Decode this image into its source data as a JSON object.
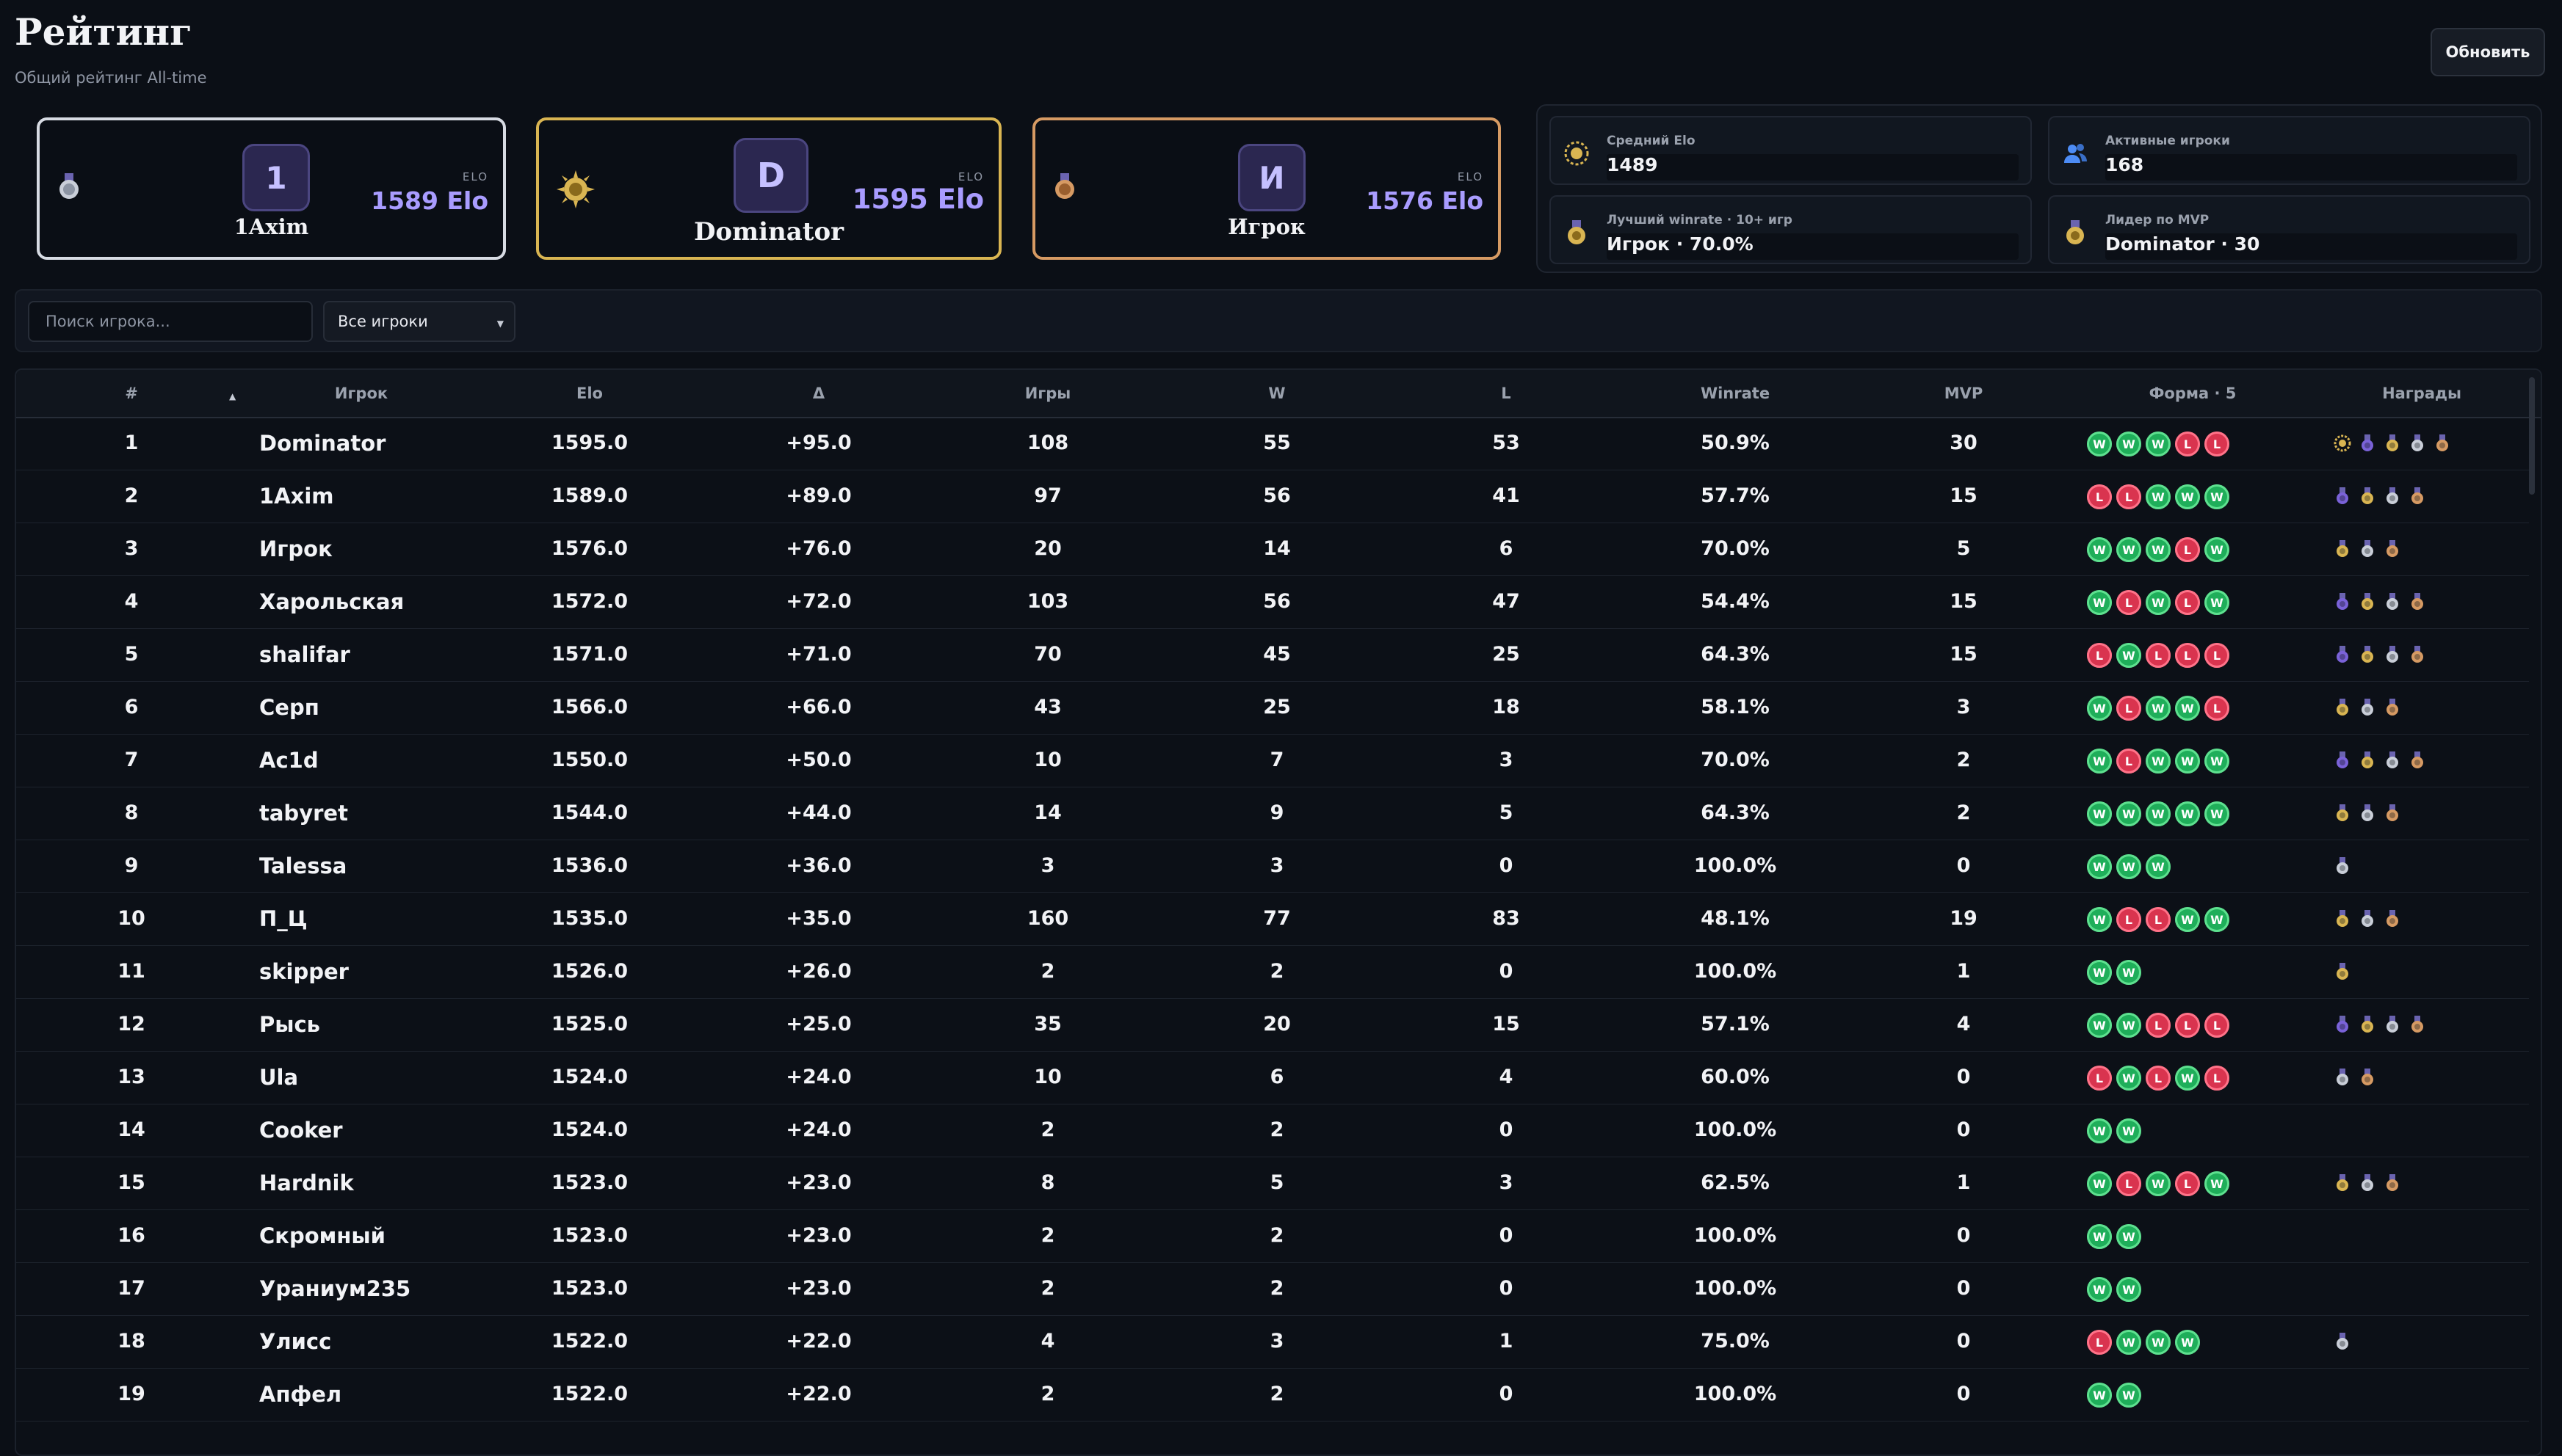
{
  "page": {
    "title": "Рейтинг",
    "subtitle": "Общий рейтинг All-time",
    "refresh_label": "Обновить"
  },
  "podium": [
    {
      "place": 2,
      "initial": "1",
      "name": "1Axim",
      "elo_label": "ELO",
      "elo": "1589 Elo",
      "medal_icon": "medal-silver-icon"
    },
    {
      "place": 1,
      "initial": "D",
      "name": "Dominator",
      "elo_label": "ELO",
      "elo": "1595 Elo",
      "medal_icon": "crown-gold-icon"
    },
    {
      "place": 3,
      "initial": "И",
      "name": "Игрок",
      "elo_label": "ELO",
      "elo": "1576 Elo",
      "medal_icon": "medal-bronze-icon"
    }
  ],
  "stats": [
    {
      "label": "Средний Elo",
      "value": "1489",
      "icon": "sun-medal-icon"
    },
    {
      "label": "Активные игроки",
      "value": "168",
      "icon": "users-icon"
    },
    {
      "label": "Лучший winrate · 10+ игр",
      "value": "Игрок · 70.0%",
      "icon": "medal-icon"
    },
    {
      "label": "Лидер по MVP",
      "value": "Dominator · 30",
      "icon": "medal-icon"
    }
  ],
  "filters": {
    "search_placeholder": "Поиск игрока...",
    "select_value": "Все игроки"
  },
  "table": {
    "headers": [
      "#",
      "Игрок",
      "Elo",
      "Δ",
      "Игры",
      "W",
      "L",
      "Winrate",
      "MVP",
      "Форма · 5",
      "Награды"
    ],
    "rows": [
      {
        "rank": "1",
        "name": "Dominator",
        "elo": "1595.0",
        "delta": "+95.0",
        "games": "108",
        "w": "55",
        "l": "53",
        "winrate": "50.9%",
        "mvp": "30",
        "form": [
          "W",
          "W",
          "W",
          "L",
          "L"
        ],
        "awards": [
          "ring",
          "purple",
          "gold",
          "silver",
          "bronze"
        ]
      },
      {
        "rank": "2",
        "name": "1Axim",
        "elo": "1589.0",
        "delta": "+89.0",
        "games": "97",
        "w": "56",
        "l": "41",
        "winrate": "57.7%",
        "mvp": "15",
        "form": [
          "L",
          "L",
          "W",
          "W",
          "W"
        ],
        "awards": [
          "purple",
          "gold",
          "silver",
          "bronze"
        ]
      },
      {
        "rank": "3",
        "name": "Игрок",
        "elo": "1576.0",
        "delta": "+76.0",
        "games": "20",
        "w": "14",
        "l": "6",
        "winrate": "70.0%",
        "mvp": "5",
        "form": [
          "W",
          "W",
          "W",
          "L",
          "W"
        ],
        "awards": [
          "gold",
          "silver",
          "bronze"
        ]
      },
      {
        "rank": "4",
        "name": "Харольская",
        "elo": "1572.0",
        "delta": "+72.0",
        "games": "103",
        "w": "56",
        "l": "47",
        "winrate": "54.4%",
        "mvp": "15",
        "form": [
          "W",
          "L",
          "W",
          "L",
          "W"
        ],
        "awards": [
          "purple",
          "gold",
          "silver",
          "bronze"
        ]
      },
      {
        "rank": "5",
        "name": "shalifar",
        "elo": "1571.0",
        "delta": "+71.0",
        "games": "70",
        "w": "45",
        "l": "25",
        "winrate": "64.3%",
        "mvp": "15",
        "form": [
          "L",
          "W",
          "L",
          "L",
          "L"
        ],
        "awards": [
          "purple",
          "gold",
          "silver",
          "bronze"
        ]
      },
      {
        "rank": "6",
        "name": "Серп",
        "elo": "1566.0",
        "delta": "+66.0",
        "games": "43",
        "w": "25",
        "l": "18",
        "winrate": "58.1%",
        "mvp": "3",
        "form": [
          "W",
          "L",
          "W",
          "W",
          "L"
        ],
        "awards": [
          "gold",
          "silver",
          "bronze"
        ]
      },
      {
        "rank": "7",
        "name": "Ac1d",
        "elo": "1550.0",
        "delta": "+50.0",
        "games": "10",
        "w": "7",
        "l": "3",
        "winrate": "70.0%",
        "mvp": "2",
        "form": [
          "W",
          "L",
          "W",
          "W",
          "W"
        ],
        "awards": [
          "purple",
          "gold",
          "silver",
          "bronze"
        ]
      },
      {
        "rank": "8",
        "name": "tabyret",
        "elo": "1544.0",
        "delta": "+44.0",
        "games": "14",
        "w": "9",
        "l": "5",
        "winrate": "64.3%",
        "mvp": "2",
        "form": [
          "W",
          "W",
          "W",
          "W",
          "W"
        ],
        "awards": [
          "gold",
          "silver",
          "bronze"
        ]
      },
      {
        "rank": "9",
        "name": "Talessa",
        "elo": "1536.0",
        "delta": "+36.0",
        "games": "3",
        "w": "3",
        "l": "0",
        "winrate": "100.0%",
        "mvp": "0",
        "form": [
          "W",
          "W",
          "W"
        ],
        "awards": [
          "silver"
        ]
      },
      {
        "rank": "10",
        "name": "П_Ц",
        "elo": "1535.0",
        "delta": "+35.0",
        "games": "160",
        "w": "77",
        "l": "83",
        "winrate": "48.1%",
        "mvp": "19",
        "form": [
          "W",
          "L",
          "L",
          "W",
          "W"
        ],
        "awards": [
          "gold",
          "silver",
          "bronze"
        ]
      },
      {
        "rank": "11",
        "name": "skipper",
        "elo": "1526.0",
        "delta": "+26.0",
        "games": "2",
        "w": "2",
        "l": "0",
        "winrate": "100.0%",
        "mvp": "1",
        "form": [
          "W",
          "W"
        ],
        "awards": [
          "gold"
        ]
      },
      {
        "rank": "12",
        "name": "Рысь",
        "elo": "1525.0",
        "delta": "+25.0",
        "games": "35",
        "w": "20",
        "l": "15",
        "winrate": "57.1%",
        "mvp": "4",
        "form": [
          "W",
          "W",
          "L",
          "L",
          "L"
        ],
        "awards": [
          "purple",
          "gold",
          "silver",
          "bronze"
        ]
      },
      {
        "rank": "13",
        "name": "Ula",
        "elo": "1524.0",
        "delta": "+24.0",
        "games": "10",
        "w": "6",
        "l": "4",
        "winrate": "60.0%",
        "mvp": "0",
        "form": [
          "L",
          "W",
          "L",
          "W",
          "L"
        ],
        "awards": [
          "silver",
          "bronze"
        ]
      },
      {
        "rank": "14",
        "name": "Cooker",
        "elo": "1524.0",
        "delta": "+24.0",
        "games": "2",
        "w": "2",
        "l": "0",
        "winrate": "100.0%",
        "mvp": "0",
        "form": [
          "W",
          "W"
        ],
        "awards": []
      },
      {
        "rank": "15",
        "name": "Hardnik",
        "elo": "1523.0",
        "delta": "+23.0",
        "games": "8",
        "w": "5",
        "l": "3",
        "winrate": "62.5%",
        "mvp": "1",
        "form": [
          "W",
          "L",
          "W",
          "L",
          "W"
        ],
        "awards": [
          "gold",
          "silver",
          "bronze"
        ]
      },
      {
        "rank": "16",
        "name": "Скромный",
        "elo": "1523.0",
        "delta": "+23.0",
        "games": "2",
        "w": "2",
        "l": "0",
        "winrate": "100.0%",
        "mvp": "0",
        "form": [
          "W",
          "W"
        ],
        "awards": []
      },
      {
        "rank": "17",
        "name": "Ураниум235",
        "elo": "1523.0",
        "delta": "+23.0",
        "games": "2",
        "w": "2",
        "l": "0",
        "winrate": "100.0%",
        "mvp": "0",
        "form": [
          "W",
          "W"
        ],
        "awards": []
      },
      {
        "rank": "18",
        "name": "Улисс",
        "elo": "1522.0",
        "delta": "+22.0",
        "games": "4",
        "w": "3",
        "l": "1",
        "winrate": "75.0%",
        "mvp": "0",
        "form": [
          "L",
          "W",
          "W",
          "W"
        ],
        "awards": [
          "silver"
        ]
      },
      {
        "rank": "19",
        "name": "Апфел",
        "elo": "1522.0",
        "delta": "+22.0",
        "games": "2",
        "w": "2",
        "l": "0",
        "winrate": "100.0%",
        "mvp": "0",
        "form": [
          "W",
          "W"
        ],
        "awards": []
      }
    ]
  },
  "colors": {
    "gold": "#d9b552",
    "silver": "#c9ced8",
    "bronze": "#d69a63",
    "purple": "#7a62d8",
    "win": "#1fae5a",
    "loss": "#d9344f",
    "accent": "#a99cff"
  }
}
